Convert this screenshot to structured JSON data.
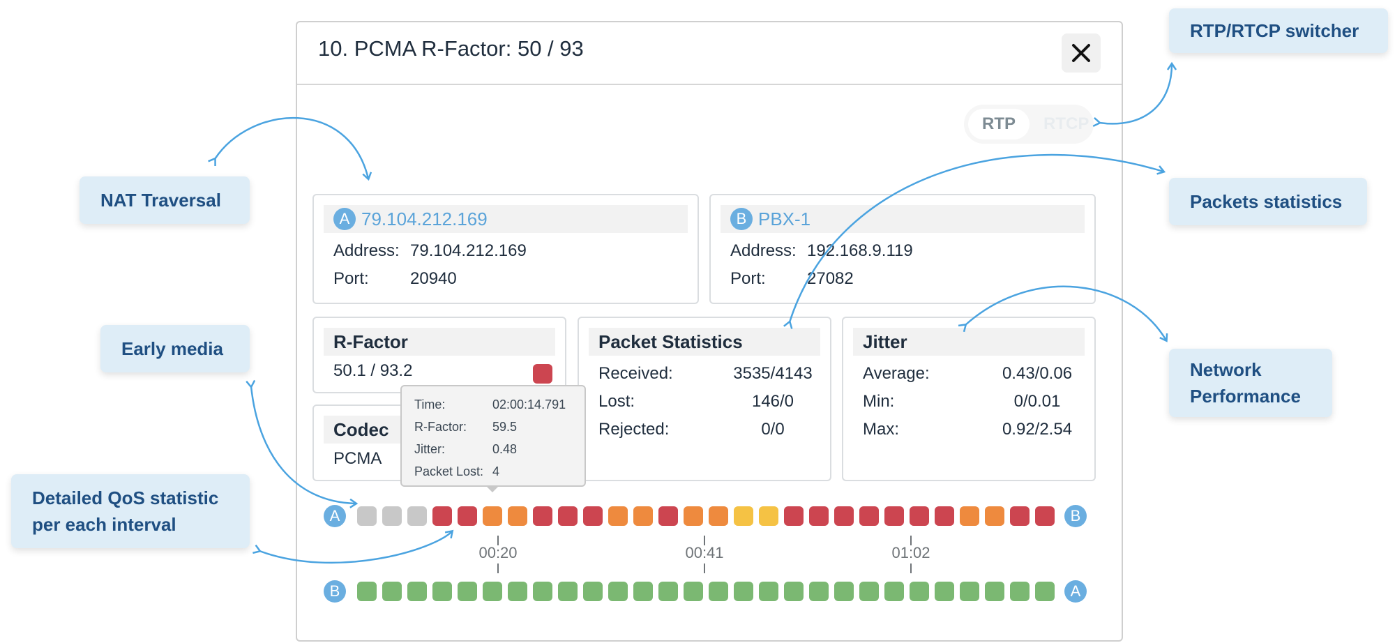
{
  "modal": {
    "title": "10. PCMA R-Factor: 50 / 93",
    "close_icon": "close-icon"
  },
  "switcher": {
    "options": [
      "RTP",
      "RTCP"
    ],
    "selected": "RTP"
  },
  "endpoint_a": {
    "badge": "A",
    "name": "79.104.212.169",
    "address_label": "Address:",
    "address": "79.104.212.169",
    "port_label": "Port:",
    "port": "20940"
  },
  "endpoint_b": {
    "badge": "B",
    "name": "PBX-1",
    "address_label": "Address:",
    "address": "192.168.9.119",
    "port_label": "Port:",
    "port": "27082"
  },
  "rfactor": {
    "title": "R-Factor",
    "value": "50.1 / 93.2",
    "status_color": "#cc4550"
  },
  "codec": {
    "title": "Codec",
    "value": "PCMA"
  },
  "packet_stats": {
    "title": "Packet Statistics",
    "rows": [
      {
        "label": "Received:",
        "value": "3535/4143"
      },
      {
        "label": "Lost:",
        "value": "146/0"
      },
      {
        "label": "Rejected:",
        "value": "0/0"
      }
    ]
  },
  "jitter": {
    "title": "Jitter",
    "rows": [
      {
        "label": "Average:",
        "value": "0.43/0.06"
      },
      {
        "label": "Min:",
        "value": "0/0.01"
      },
      {
        "label": "Max:",
        "value": "0.92/2.54"
      }
    ]
  },
  "tooltip": {
    "rows": [
      {
        "label": "Time:",
        "value": "02:00:14.791"
      },
      {
        "label": "R-Factor:",
        "value": "59.5"
      },
      {
        "label": "Jitter:",
        "value": "0.48"
      },
      {
        "label": "Packet Lost:",
        "value": "4"
      }
    ]
  },
  "timeline": {
    "colors": {
      "gray": "#c8c8c8",
      "red": "#cc4550",
      "orange": "#ee8a3e",
      "yellow": "#f5c244",
      "green": "#7bb872"
    },
    "row_a": {
      "start_badge": "A",
      "end_badge": "B",
      "intervals": [
        "gray",
        "gray",
        "gray",
        "red",
        "red",
        "orange",
        "orange",
        "red",
        "red",
        "red",
        "orange",
        "orange",
        "red",
        "orange",
        "orange",
        "yellow",
        "yellow",
        "red",
        "red",
        "red",
        "red",
        "red",
        "red",
        "red",
        "orange",
        "orange",
        "red",
        "red"
      ]
    },
    "row_b": {
      "start_badge": "B",
      "end_badge": "A",
      "intervals": [
        "green",
        "green",
        "green",
        "green",
        "green",
        "green",
        "green",
        "green",
        "green",
        "green",
        "green",
        "green",
        "green",
        "green",
        "green",
        "green",
        "green",
        "green",
        "green",
        "green",
        "green",
        "green",
        "green",
        "green",
        "green",
        "green",
        "green",
        "green"
      ]
    },
    "ticks": [
      "00:20",
      "00:41",
      "01:02"
    ]
  },
  "callouts": {
    "rtp_switcher": "RTP/RTCP switcher",
    "nat_traversal": "NAT Traversal",
    "packets_statistics": "Packets statistics",
    "early_media": "Early media",
    "network_performance": [
      "Network",
      "Performance"
    ],
    "detailed_qos": [
      "Detailed QoS statistic",
      "per each interval"
    ]
  }
}
